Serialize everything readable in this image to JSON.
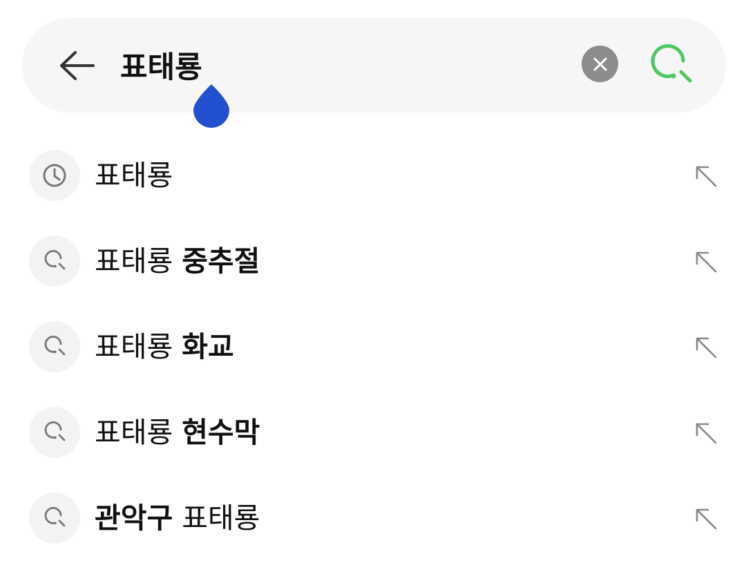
{
  "search": {
    "query": "표태룡",
    "back_icon": "arrow-left-icon",
    "clear_icon": "close-icon",
    "search_icon": "search-icon",
    "accent_color": "#4cc864",
    "handle_color": "#2150d0"
  },
  "suggestions": [
    {
      "type": "history",
      "icon": "clock-icon",
      "prefix": "",
      "normal": "표태룡",
      "bold": ""
    },
    {
      "type": "suggest",
      "icon": "search-icon",
      "prefix": "",
      "normal": "표태룡 ",
      "bold": "중추절"
    },
    {
      "type": "suggest",
      "icon": "search-icon",
      "prefix": "",
      "normal": "표태룡 ",
      "bold": "화교"
    },
    {
      "type": "suggest",
      "icon": "search-icon",
      "prefix": "",
      "normal": "표태룡 ",
      "bold": "현수막"
    },
    {
      "type": "suggest",
      "icon": "search-icon",
      "prefix": "관악구",
      "normal": " 표태룡",
      "bold": ""
    }
  ]
}
